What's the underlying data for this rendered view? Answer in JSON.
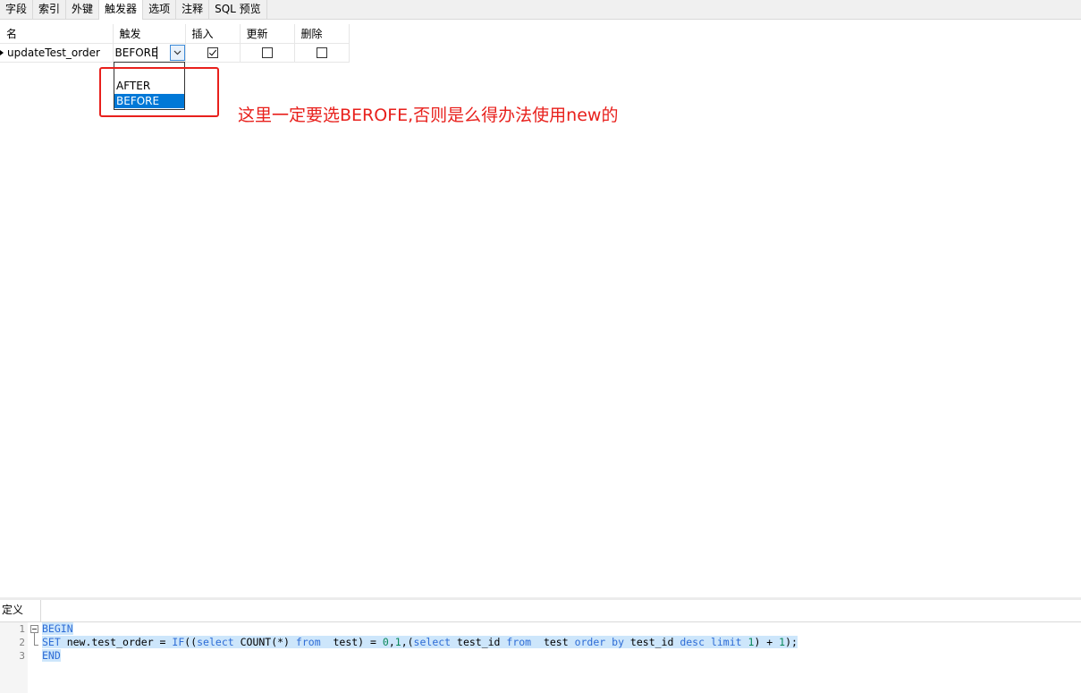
{
  "tabs": [
    "字段",
    "索引",
    "外键",
    "触发器",
    "选项",
    "注释",
    "SQL 预览"
  ],
  "active_tab_index": 3,
  "grid": {
    "headers": [
      "名",
      "触发",
      "插入",
      "更新",
      "删除"
    ],
    "row": {
      "name": "updateTest_order",
      "trigger_value": "BEFORE",
      "insert_checked": true,
      "update_checked": false,
      "delete_checked": false
    }
  },
  "dropdown": {
    "options": [
      "AFTER",
      "BEFORE"
    ],
    "selected_index": 1
  },
  "annotation": {
    "text": "这里一定要选BEROFE,否则是么得办法使用new的",
    "color": "#e8201c"
  },
  "definition": {
    "tab_label": "定义",
    "line_numbers": [
      "1",
      "2",
      "3"
    ],
    "lines": [
      [
        {
          "t": "BEGIN",
          "k": "kw"
        }
      ],
      [
        {
          "t": "SET",
          "k": "kw"
        },
        {
          "t": " new.test_order = ",
          "k": ""
        },
        {
          "t": "IF",
          "k": "kw"
        },
        {
          "t": "((",
          "k": ""
        },
        {
          "t": "select",
          "k": "kw"
        },
        {
          "t": " COUNT(*) ",
          "k": ""
        },
        {
          "t": "from",
          "k": "kw"
        },
        {
          "t": "  test) = ",
          "k": ""
        },
        {
          "t": "0",
          "k": "num"
        },
        {
          "t": ",",
          "k": ""
        },
        {
          "t": "1",
          "k": "num"
        },
        {
          "t": ",(",
          "k": ""
        },
        {
          "t": "select",
          "k": "kw"
        },
        {
          "t": " test_id ",
          "k": ""
        },
        {
          "t": "from",
          "k": "kw"
        },
        {
          "t": "  test ",
          "k": ""
        },
        {
          "t": "order",
          "k": "kw"
        },
        {
          "t": " ",
          "k": ""
        },
        {
          "t": "by",
          "k": "kw"
        },
        {
          "t": " test_id ",
          "k": ""
        },
        {
          "t": "desc",
          "k": "kw"
        },
        {
          "t": " ",
          "k": ""
        },
        {
          "t": "limit",
          "k": "kw"
        },
        {
          "t": " ",
          "k": ""
        },
        {
          "t": "1",
          "k": "num"
        },
        {
          "t": ") + ",
          "k": ""
        },
        {
          "t": "1",
          "k": "num"
        },
        {
          "t": ");",
          "k": ""
        }
      ],
      [
        {
          "t": "END",
          "k": "kw"
        }
      ]
    ]
  }
}
